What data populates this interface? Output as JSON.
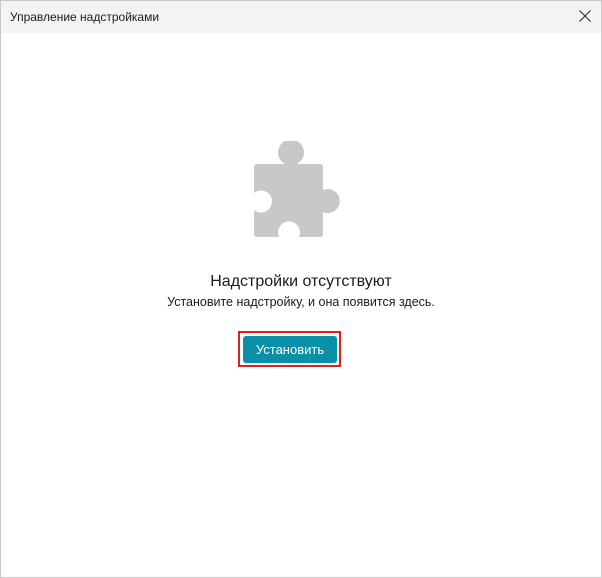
{
  "window": {
    "title": "Управление надстройками"
  },
  "empty_state": {
    "icon": "puzzle-piece-icon",
    "heading": "Надстройки отсутствуют",
    "message": "Установите надстройку, и она появится здесь.",
    "install_label": "Установить"
  },
  "colors": {
    "accent": "#0a8fa8",
    "icon_gray": "#c8c8c8",
    "highlight": "#e0201b"
  }
}
